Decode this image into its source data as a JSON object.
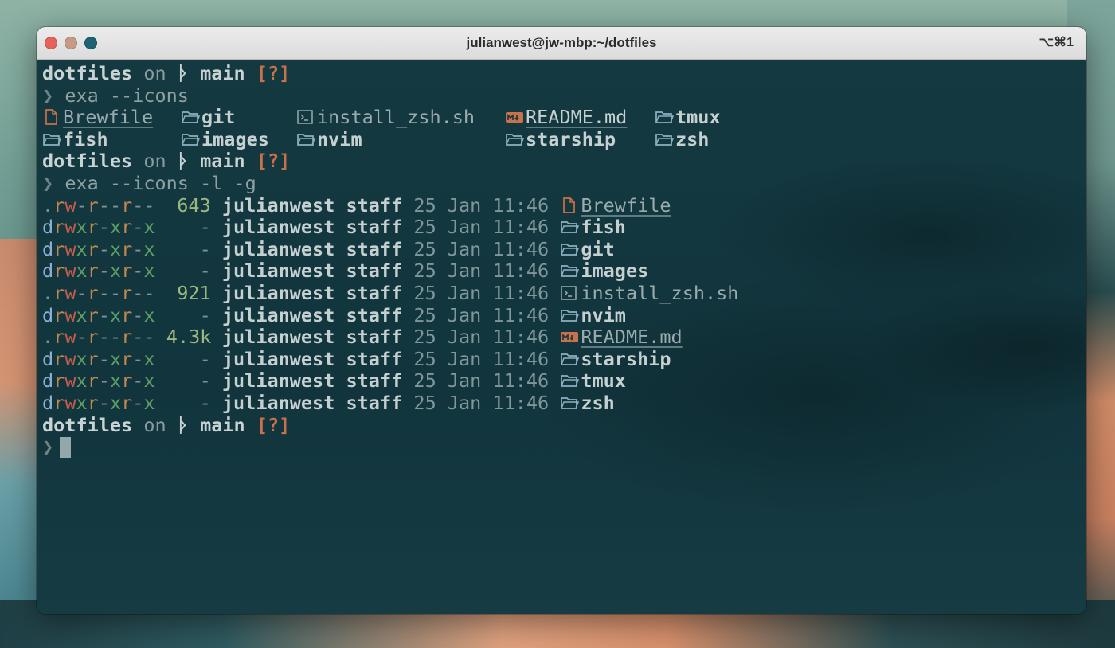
{
  "window": {
    "title": "julianwest@jw-mbp:~/dotfiles",
    "shortcut": "⌥⌘1"
  },
  "prompt": {
    "dir": "dotfiles",
    "on": "on",
    "branch_glyph": "ᚦ",
    "branch": "main",
    "status": "[?]",
    "symbol": "❯"
  },
  "commands": {
    "first": "exa --icons",
    "second": "exa --icons -l -g"
  },
  "grid_listing": {
    "row1": [
      "Brewfile",
      "git",
      "install_zsh.sh",
      "README.md",
      "tmux"
    ],
    "row2": [
      "fish",
      "images",
      "nvim",
      "starship",
      "zsh"
    ]
  },
  "long_listing": [
    {
      "perms": ".rw-r--r--",
      "size": "643",
      "user": "julianwest",
      "group": "staff",
      "date": "25 Jan 11:46",
      "icon": "file-icon",
      "name": "Brewfile"
    },
    {
      "perms": "drwxr-xr-x",
      "size": "-",
      "user": "julianwest",
      "group": "staff",
      "date": "25 Jan 11:46",
      "icon": "folder-icon",
      "name": "fish"
    },
    {
      "perms": "drwxr-xr-x",
      "size": "-",
      "user": "julianwest",
      "group": "staff",
      "date": "25 Jan 11:46",
      "icon": "folder-icon",
      "name": "git"
    },
    {
      "perms": "drwxr-xr-x",
      "size": "-",
      "user": "julianwest",
      "group": "staff",
      "date": "25 Jan 11:46",
      "icon": "folder-icon",
      "name": "images"
    },
    {
      "perms": ".rw-r--r--",
      "size": "921",
      "user": "julianwest",
      "group": "staff",
      "date": "25 Jan 11:46",
      "icon": "terminal-icon",
      "name": "install_zsh.sh"
    },
    {
      "perms": "drwxr-xr-x",
      "size": "-",
      "user": "julianwest",
      "group": "staff",
      "date": "25 Jan 11:46",
      "icon": "folder-icon",
      "name": "nvim"
    },
    {
      "perms": ".rw-r--r--",
      "size": "4.3k",
      "user": "julianwest",
      "group": "staff",
      "date": "25 Jan 11:46",
      "icon": "markdown-icon",
      "name": "README.md"
    },
    {
      "perms": "drwxr-xr-x",
      "size": "-",
      "user": "julianwest",
      "group": "staff",
      "date": "25 Jan 11:46",
      "icon": "folder-icon",
      "name": "starship"
    },
    {
      "perms": "drwxr-xr-x",
      "size": "-",
      "user": "julianwest",
      "group": "staff",
      "date": "25 Jan 11:46",
      "icon": "folder-icon",
      "name": "tmux"
    },
    {
      "perms": "drwxr-xr-x",
      "size": "-",
      "user": "julianwest",
      "group": "staff",
      "date": "25 Jan 11:46",
      "icon": "folder-icon",
      "name": "zsh"
    }
  ],
  "colors": {
    "terminal_bg": "#133840",
    "accent_orange": "#c9714a",
    "text": "#c6d0d1"
  }
}
